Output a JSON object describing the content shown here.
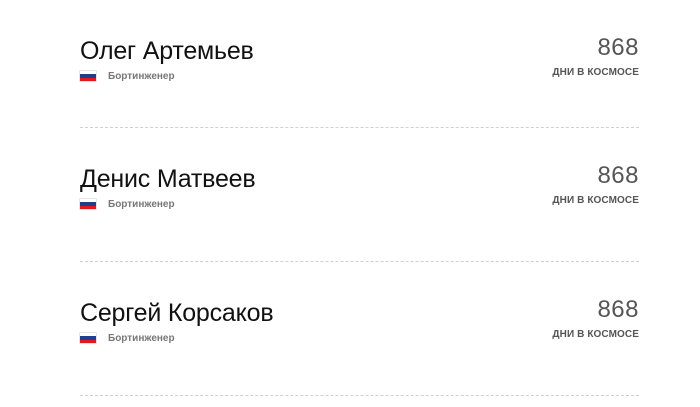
{
  "crew": [
    {
      "name": "Олег Артемьев",
      "role": "Бортинженер",
      "country_flag": "russia-flag-icon",
      "days_value": "868",
      "days_label": "ДНИ В КОСМОСЕ"
    },
    {
      "name": "Денис Матвеев",
      "role": "Бортинженер",
      "country_flag": "russia-flag-icon",
      "days_value": "868",
      "days_label": "ДНИ В КОСМОСЕ"
    },
    {
      "name": "Сергей Корсаков",
      "role": "Бортинженер",
      "country_flag": "russia-flag-icon",
      "days_value": "868",
      "days_label": "ДНИ В КОСМОСЕ"
    }
  ],
  "flag_colors": {
    "white": "#ffffff",
    "blue": "#1c3f94",
    "red": "#e4181c"
  },
  "separator_color": "#d0d0d0"
}
